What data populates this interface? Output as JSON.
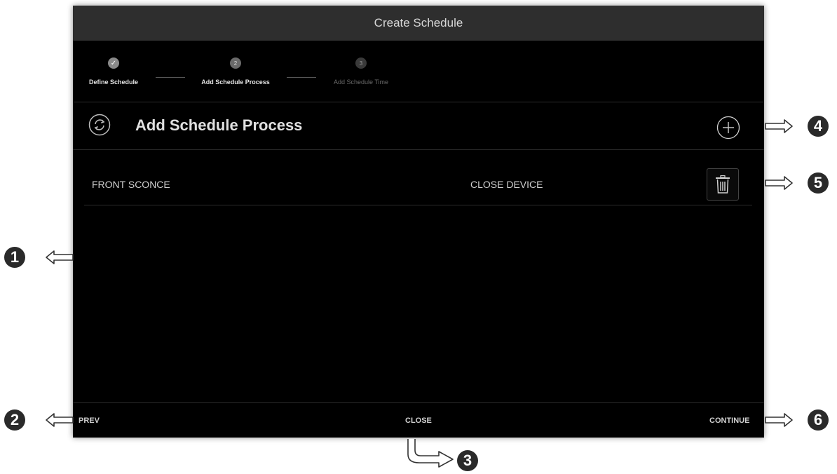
{
  "dialog": {
    "title": "Create Schedule"
  },
  "stepper": {
    "steps": [
      {
        "number": "1",
        "label": "Define Schedule",
        "state": "done"
      },
      {
        "number": "2",
        "label": "Add Schedule Process",
        "state": "current"
      },
      {
        "number": "3",
        "label": "Add Schedule Time",
        "state": "future"
      }
    ],
    "done_glyph": "✓"
  },
  "section": {
    "title": "Add Schedule Process",
    "icon": "refresh-cycle-icon",
    "add_icon": "plus-circle-icon"
  },
  "processes": [
    {
      "device": "FRONT SCONCE",
      "action": "CLOSE DEVICE",
      "delete_icon": "trash-icon"
    }
  ],
  "footer": {
    "prev_label": "PREV",
    "close_label": "CLOSE",
    "continue_label": "CONTINUE"
  },
  "callouts": [
    "1",
    "2",
    "3",
    "4",
    "5",
    "6"
  ]
}
